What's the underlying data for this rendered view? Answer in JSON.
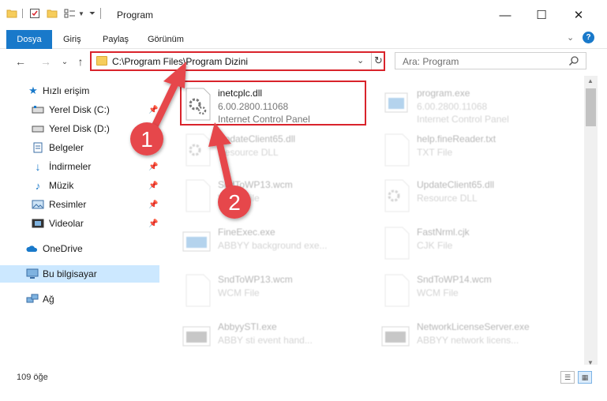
{
  "window": {
    "title": "Program",
    "minimize": "—",
    "maximize": "☐",
    "close": "✕"
  },
  "ribbon": {
    "tabs": [
      "Dosya",
      "Giriş",
      "Paylaş",
      "Görünüm"
    ],
    "expand": "⌄",
    "help": "?"
  },
  "address": {
    "path": "C:\\Program Files\\Program Dizini",
    "dropdown": "⌄",
    "refresh": "↻"
  },
  "search": {
    "placeholder": "Ara: Program"
  },
  "nav": {
    "back": "←",
    "forward": "→",
    "recent": "⌄",
    "up": "↑"
  },
  "sidebar": {
    "items": [
      {
        "label": "Hızlı erişim",
        "icon": "star-icon"
      },
      {
        "label": "Yerel Disk (C:)",
        "icon": "drive-icon",
        "pinned": true
      },
      {
        "label": "Yerel Disk (D:)",
        "icon": "drive-icon",
        "pinned": true
      },
      {
        "label": "Belgeler",
        "icon": "documents-icon",
        "pinned": true
      },
      {
        "label": "İndirmeler",
        "icon": "download-icon",
        "pinned": true
      },
      {
        "label": "Müzik",
        "icon": "music-icon",
        "pinned": true
      },
      {
        "label": "Resimler",
        "icon": "pictures-icon",
        "pinned": true
      },
      {
        "label": "Videolar",
        "icon": "videos-icon",
        "pinned": true
      },
      {
        "label": "OneDrive",
        "icon": "cloud-icon"
      },
      {
        "label": "Bu bilgisayar",
        "icon": "computer-icon",
        "selected": true
      },
      {
        "label": "Ağ",
        "icon": "network-icon"
      }
    ]
  },
  "files": [
    {
      "name": "inetcplc.dll",
      "line2": "6.00.2800.11068",
      "line3": "Internet Control Panel",
      "icon": "dll-gear-icon",
      "faded": false
    },
    {
      "name": "program.exe",
      "line2": "6.00.2800.11068",
      "line3": "Internet Control Panel",
      "icon": "exe-icon",
      "faded": true
    },
    {
      "name": "UpdateClient65.dll",
      "line2": "Resource DLL",
      "line3": "",
      "icon": "dll-gear-icon",
      "faded": true
    },
    {
      "name": "help.fineReader.txt",
      "line2": "TXT File",
      "line3": "",
      "icon": "text-file-icon",
      "faded": true
    },
    {
      "name": "SndToWP13.wcm",
      "line2": "WCM File",
      "line3": "",
      "icon": "blank-file-icon",
      "faded": true
    },
    {
      "name": "UpdateClient65.dll",
      "line2": "Resource DLL",
      "line3": "",
      "icon": "dll-gear-icon",
      "faded": true
    },
    {
      "name": "FineExec.exe",
      "line2": "ABBYY background exe...",
      "line3": "",
      "icon": "exe-icon",
      "faded": true
    },
    {
      "name": "FastNrml.cjk",
      "line2": "CJK File",
      "line3": "",
      "icon": "blank-file-icon",
      "faded": true
    },
    {
      "name": "SndToWP13.wcm",
      "line2": "WCM File",
      "line3": "",
      "icon": "blank-file-icon",
      "faded": true
    },
    {
      "name": "SndToWP14.wcm",
      "line2": "WCM File",
      "line3": "",
      "icon": "blank-file-icon",
      "faded": true
    },
    {
      "name": "AbbyySTI.exe",
      "line2": "ABBY sti event hand...",
      "line3": "",
      "icon": "exe-icon",
      "faded": true
    },
    {
      "name": "NetworkLicenseServer.exe",
      "line2": "ABBYY network licens...",
      "line3": "",
      "icon": "exe-icon",
      "faded": true
    }
  ],
  "annotations": {
    "badge1": "1",
    "badge2": "2",
    "color": "#e6464b"
  },
  "status": {
    "count": "109 öğe"
  },
  "colors": {
    "accent": "#1979ca",
    "highlight_border": "#d9232b",
    "selected_nav": "#cce8ff"
  }
}
